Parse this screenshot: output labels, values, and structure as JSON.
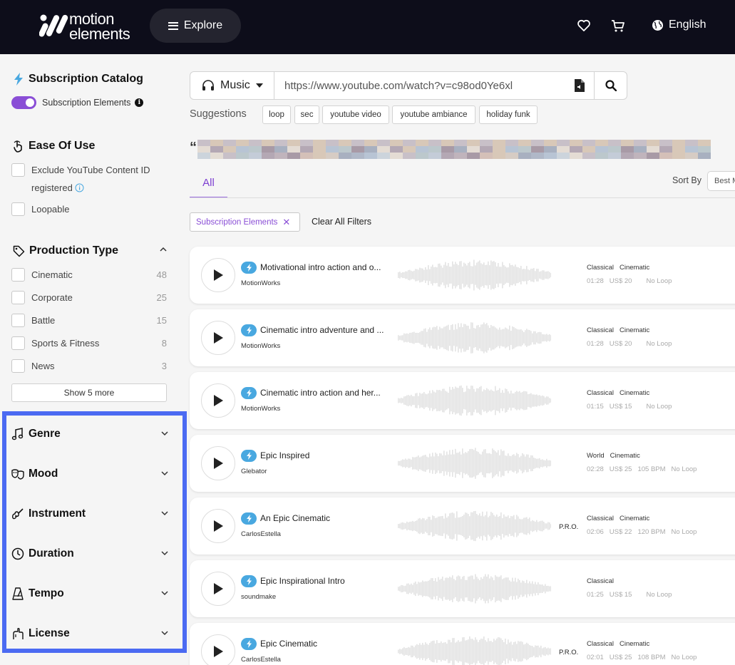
{
  "header": {
    "logo_line1": "motion",
    "logo_line2": "elements",
    "explore_label": "Explore",
    "language": "English"
  },
  "sidebar": {
    "subscription_title": "Subscription Catalog",
    "subscription_toggle_label": "Subscription Elements",
    "ease_title": "Ease Of Use",
    "ease_options": [
      {
        "label": "Exclude YouTube Content ID",
        "label2": "registered"
      },
      {
        "label": "Loopable"
      }
    ],
    "production_title": "Production Type",
    "production_options": [
      {
        "label": "Cinematic",
        "count": "48"
      },
      {
        "label": "Corporate",
        "count": "25"
      },
      {
        "label": "Battle",
        "count": "15"
      },
      {
        "label": "Sports & Fitness",
        "count": "8"
      },
      {
        "label": "News",
        "count": "3"
      }
    ],
    "show_more_label": "Show 5 more",
    "filters": [
      "Genre",
      "Mood",
      "Instrument",
      "Duration",
      "Tempo",
      "License"
    ]
  },
  "search": {
    "category": "Music",
    "url": "https://www.youtube.com/watch?v=c98od0Ye6xl",
    "suggestions_label": "Suggestions",
    "suggestions": [
      "loop",
      "sec",
      "youtube video",
      "youtube ambiance",
      "holiday funk"
    ]
  },
  "quote_mark": "“",
  "tabs": {
    "all": "All"
  },
  "sort": {
    "label": "Sort By",
    "value": "Best M"
  },
  "active_filter": "Subscription Elements",
  "clear_filters_label": "Clear All Filters",
  "tracks": [
    {
      "title": "Motivational intro action and o...",
      "author": "MotionWorks",
      "tags": [
        "Classical",
        "Cinematic"
      ],
      "duration": "01:28",
      "price": "US$ 20",
      "bpm": "",
      "loop": "No Loop",
      "pro": ""
    },
    {
      "title": "Cinematic intro adventure and ...",
      "author": "MotionWorks",
      "tags": [
        "Classical",
        "Cinematic"
      ],
      "duration": "01:28",
      "price": "US$ 20",
      "bpm": "",
      "loop": "No Loop",
      "pro": ""
    },
    {
      "title": "Cinematic intro action and her...",
      "author": "MotionWorks",
      "tags": [
        "Classical",
        "Cinematic"
      ],
      "duration": "01:15",
      "price": "US$ 15",
      "bpm": "",
      "loop": "No Loop",
      "pro": ""
    },
    {
      "title": "Epic Inspired",
      "author": "Glebator",
      "tags": [
        "World",
        "Cinematic"
      ],
      "duration": "02:28",
      "price": "US$ 25",
      "bpm": "105 BPM",
      "loop": "No Loop",
      "pro": ""
    },
    {
      "title": "An Epic Cinematic",
      "author": "CarlosEstella",
      "tags": [
        "Classical",
        "Cinematic"
      ],
      "duration": "02:06",
      "price": "US$ 22",
      "bpm": "120 BPM",
      "loop": "No Loop",
      "pro": "P.R.O."
    },
    {
      "title": "Epic Inspirational Intro",
      "author": "soundmake",
      "tags": [
        "Classical"
      ],
      "duration": "01:25",
      "price": "US$ 15",
      "bpm": "",
      "loop": "No Loop",
      "pro": ""
    },
    {
      "title": "Epic Cinematic",
      "author": "CarlosEstella",
      "tags": [
        "Classical",
        "Cinematic"
      ],
      "duration": "02:01",
      "price": "US$ 25",
      "bpm": "108 BPM",
      "loop": "No Loop",
      "pro": "P.R.O."
    }
  ],
  "colors": {
    "topbar": "#0d0d1a",
    "accent_purple": "#8a4ed6",
    "bolt_blue": "#49a8e0",
    "highlight_border": "#4b6af2"
  }
}
